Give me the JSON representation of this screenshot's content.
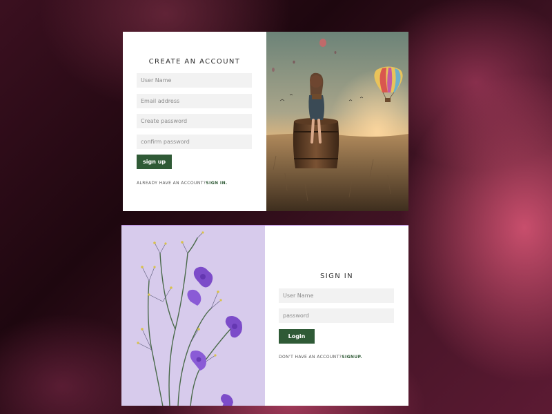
{
  "signup": {
    "title": "CREATE AN ACCOUNT",
    "username_placeholder": "User Name",
    "email_placeholder": "Email address",
    "password_placeholder": "Create password",
    "confirm_placeholder": "confirm password",
    "button_label": "sign up",
    "prompt_text": "ALREADY HAVE AN ACCOUNT?",
    "link_text": "SIGN IN."
  },
  "signin": {
    "title": "SIGN IN",
    "username_placeholder": "User Name",
    "password_placeholder": "password",
    "button_label": "Login",
    "prompt_text": "DON'T HAVE AN ACCOUNT?",
    "link_text": "SIGNUP."
  },
  "colors": {
    "accent": "#2f5a36",
    "field_bg": "#f2f2f2",
    "card_bg": "#ffffff"
  }
}
